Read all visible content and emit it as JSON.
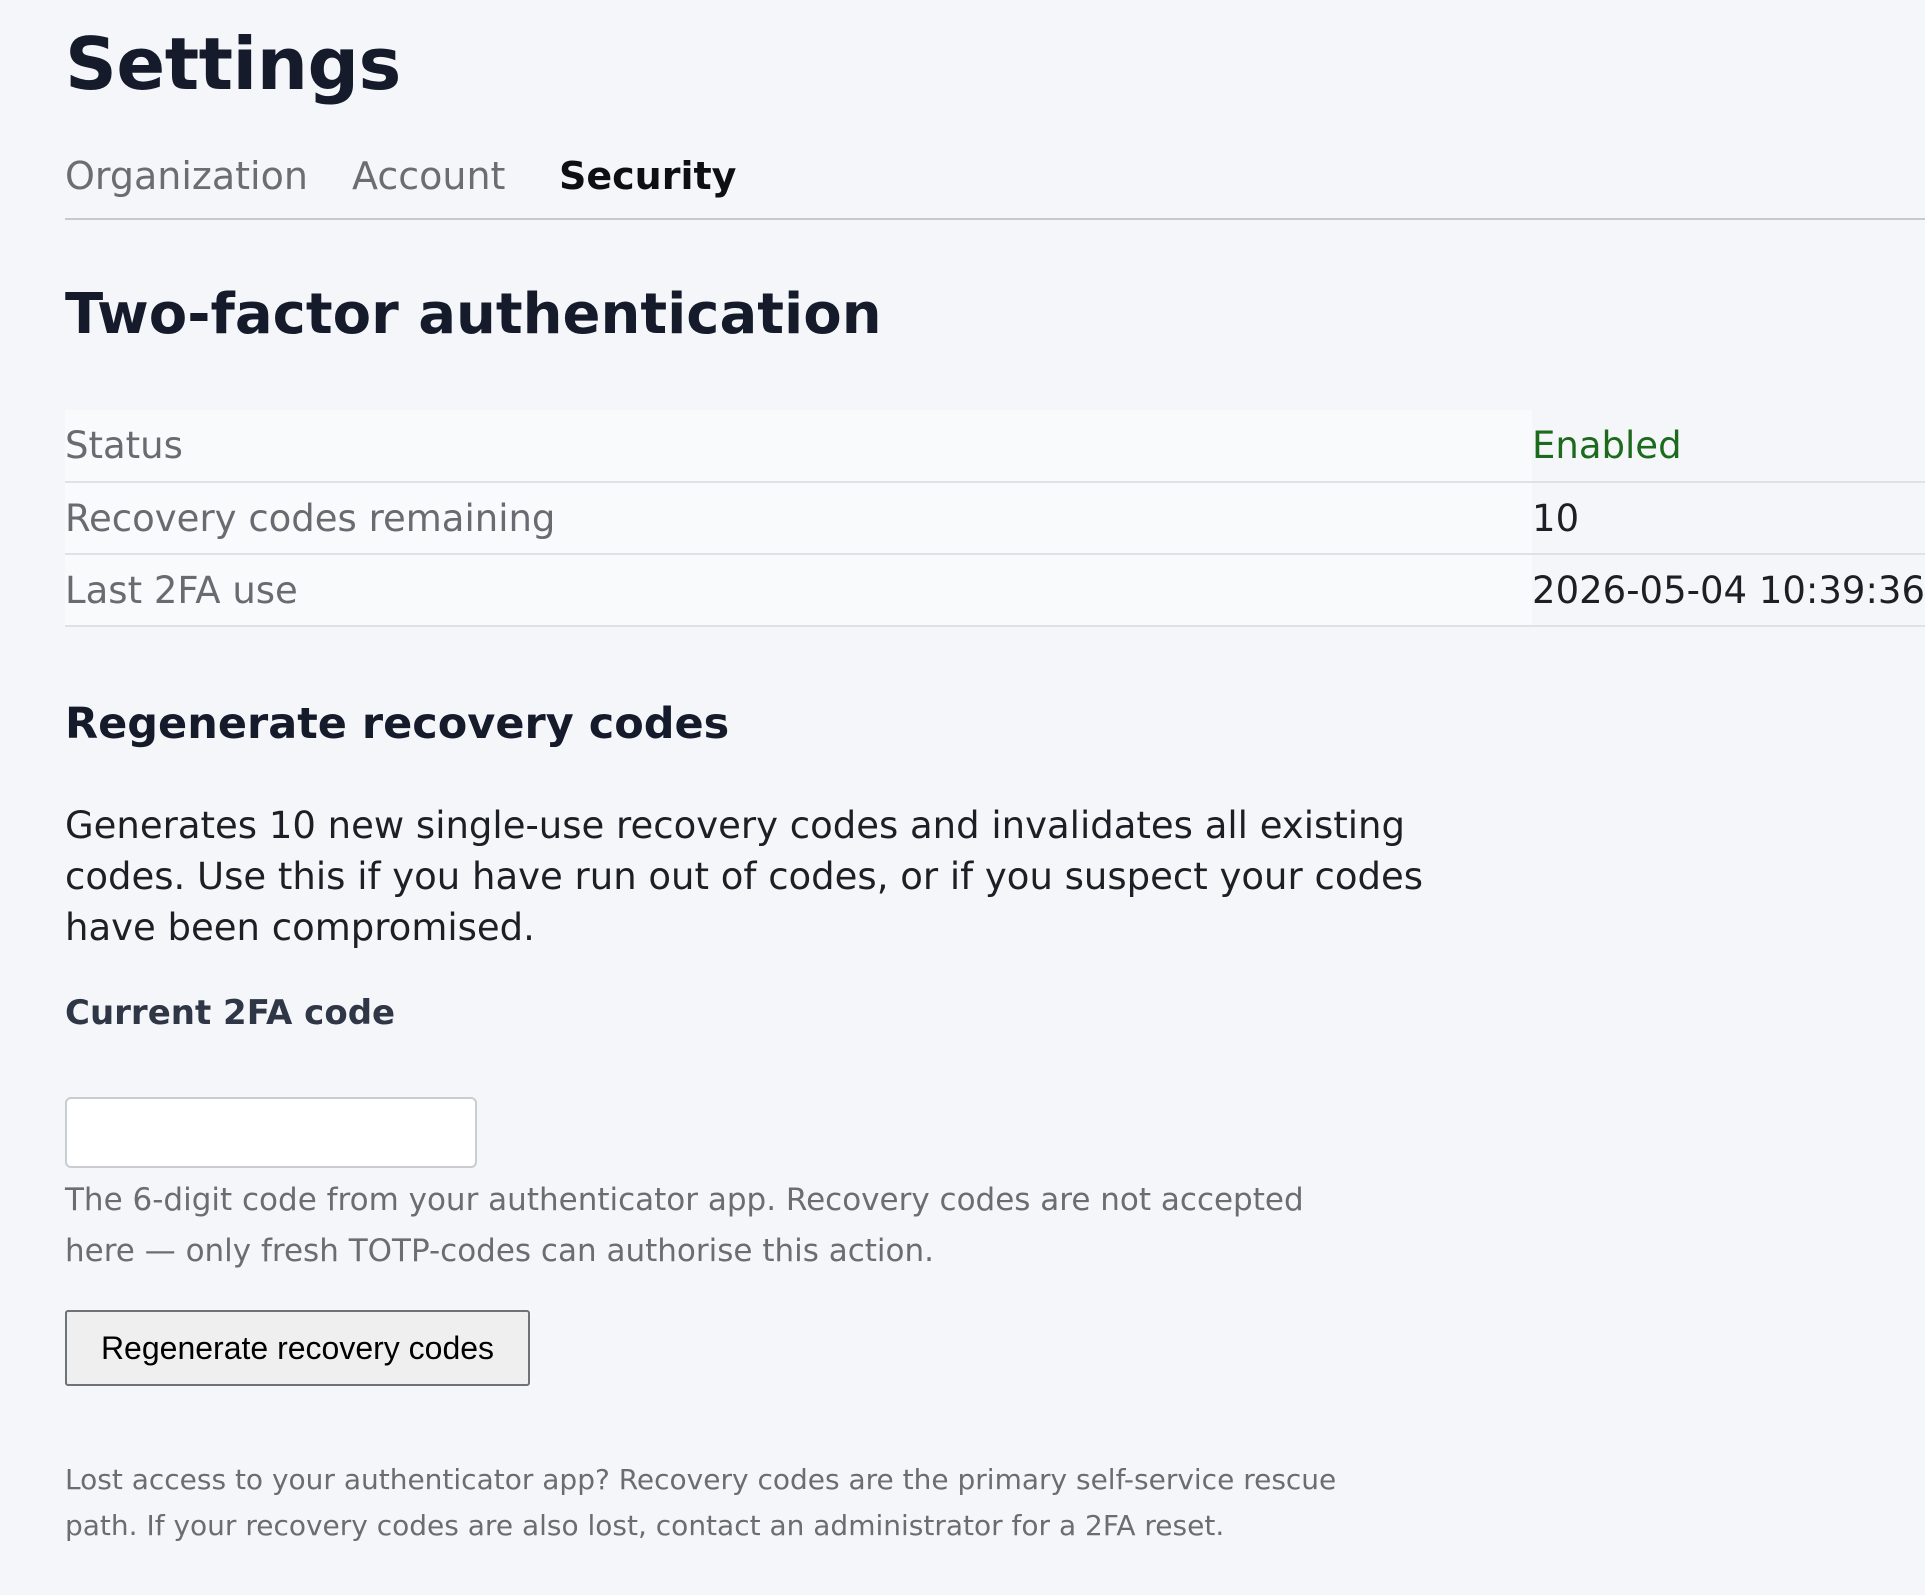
{
  "header": {
    "title": "Settings"
  },
  "tabs": [
    {
      "label": "Organization",
      "active": false
    },
    {
      "label": "Account",
      "active": false
    },
    {
      "label": "Security",
      "active": true
    }
  ],
  "two_factor": {
    "title": "Two-factor authentication",
    "rows": [
      {
        "label": "Status",
        "value": "Enabled"
      },
      {
        "label": "Recovery codes remaining",
        "value": "10"
      },
      {
        "label": "Last 2FA use",
        "value": "2026-05-04 10:39:36"
      }
    ]
  },
  "regenerate": {
    "title": "Regenerate recovery codes",
    "description": "Generates 10 new single-use recovery codes and invalidates all existing codes. Use this if you have run out of codes, or if you suspect your codes have been compromised.",
    "field_label": "Current 2FA code",
    "input_value": "",
    "input_placeholder": "",
    "help_text": "The 6-digit code from your authenticator app. Recovery codes are not accepted here — only fresh TOTP-codes can authorise this action.",
    "button_label": "Regenerate recovery codes"
  },
  "footer": {
    "note": "Lost access to your authenticator app? Recovery codes are the primary self-service rescue path. If your recovery codes are also lost, contact an administrator for a 2FA reset."
  },
  "colors": {
    "background": "#f5f6f9",
    "status_enabled": "#1c6a1c",
    "heading": "#151b2b"
  }
}
